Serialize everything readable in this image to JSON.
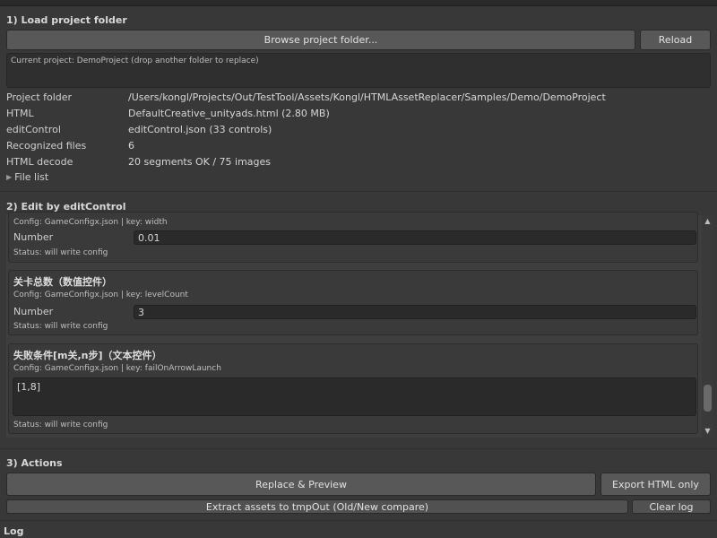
{
  "section1": {
    "title": "1) Load project folder",
    "browse_button": "Browse project folder...",
    "reload_button": "Reload",
    "current_project": "Current project: DemoProject (drop another folder to replace)"
  },
  "info": {
    "project_folder_label": "Project folder",
    "project_folder_value": "/Users/kongl/Projects/Out/TestTool/Assets/Kongl/HTMLAssetReplacer/Samples/Demo/DemoProject",
    "html_label": "HTML",
    "html_value": "DefaultCreative_unityads.html (2.80 MB)",
    "editcontrol_label": "editControl",
    "editcontrol_value": "editControl.json (33 controls)",
    "recognized_label": "Recognized files",
    "recognized_value": "6",
    "decode_label": "HTML decode",
    "decode_value": "20 segments OK / 75 images",
    "file_list_label": "File list"
  },
  "section2": {
    "title": "2) Edit by editControl",
    "cards": [
      {
        "config": "Config: GameConfigx.json | key: width",
        "field_label": "Number",
        "value": "0.01",
        "status": "Status: will write config"
      },
      {
        "title": "关卡总数（数值控件）",
        "config": "Config: GameConfigx.json | key: levelCount",
        "field_label": "Number",
        "value": "3",
        "status": "Status: will write config"
      },
      {
        "title": "失败条件[m关,n步]（文本控件）",
        "config": "Config: GameConfigx.json | key: failOnArrowLaunch",
        "value": "[1,8]",
        "status": "Status: will write config"
      }
    ],
    "scroll_fraction": 0.92
  },
  "section3": {
    "title": "3) Actions",
    "replace_preview": "Replace & Preview",
    "export_html": "Export HTML only",
    "extract_assets": "Extract assets to tmpOut (Old/New compare)",
    "clear_log": "Clear log"
  },
  "log": {
    "title": "Log"
  },
  "colors": {
    "background": "#383838",
    "button": "#585858",
    "field": "#2a2a2a"
  }
}
